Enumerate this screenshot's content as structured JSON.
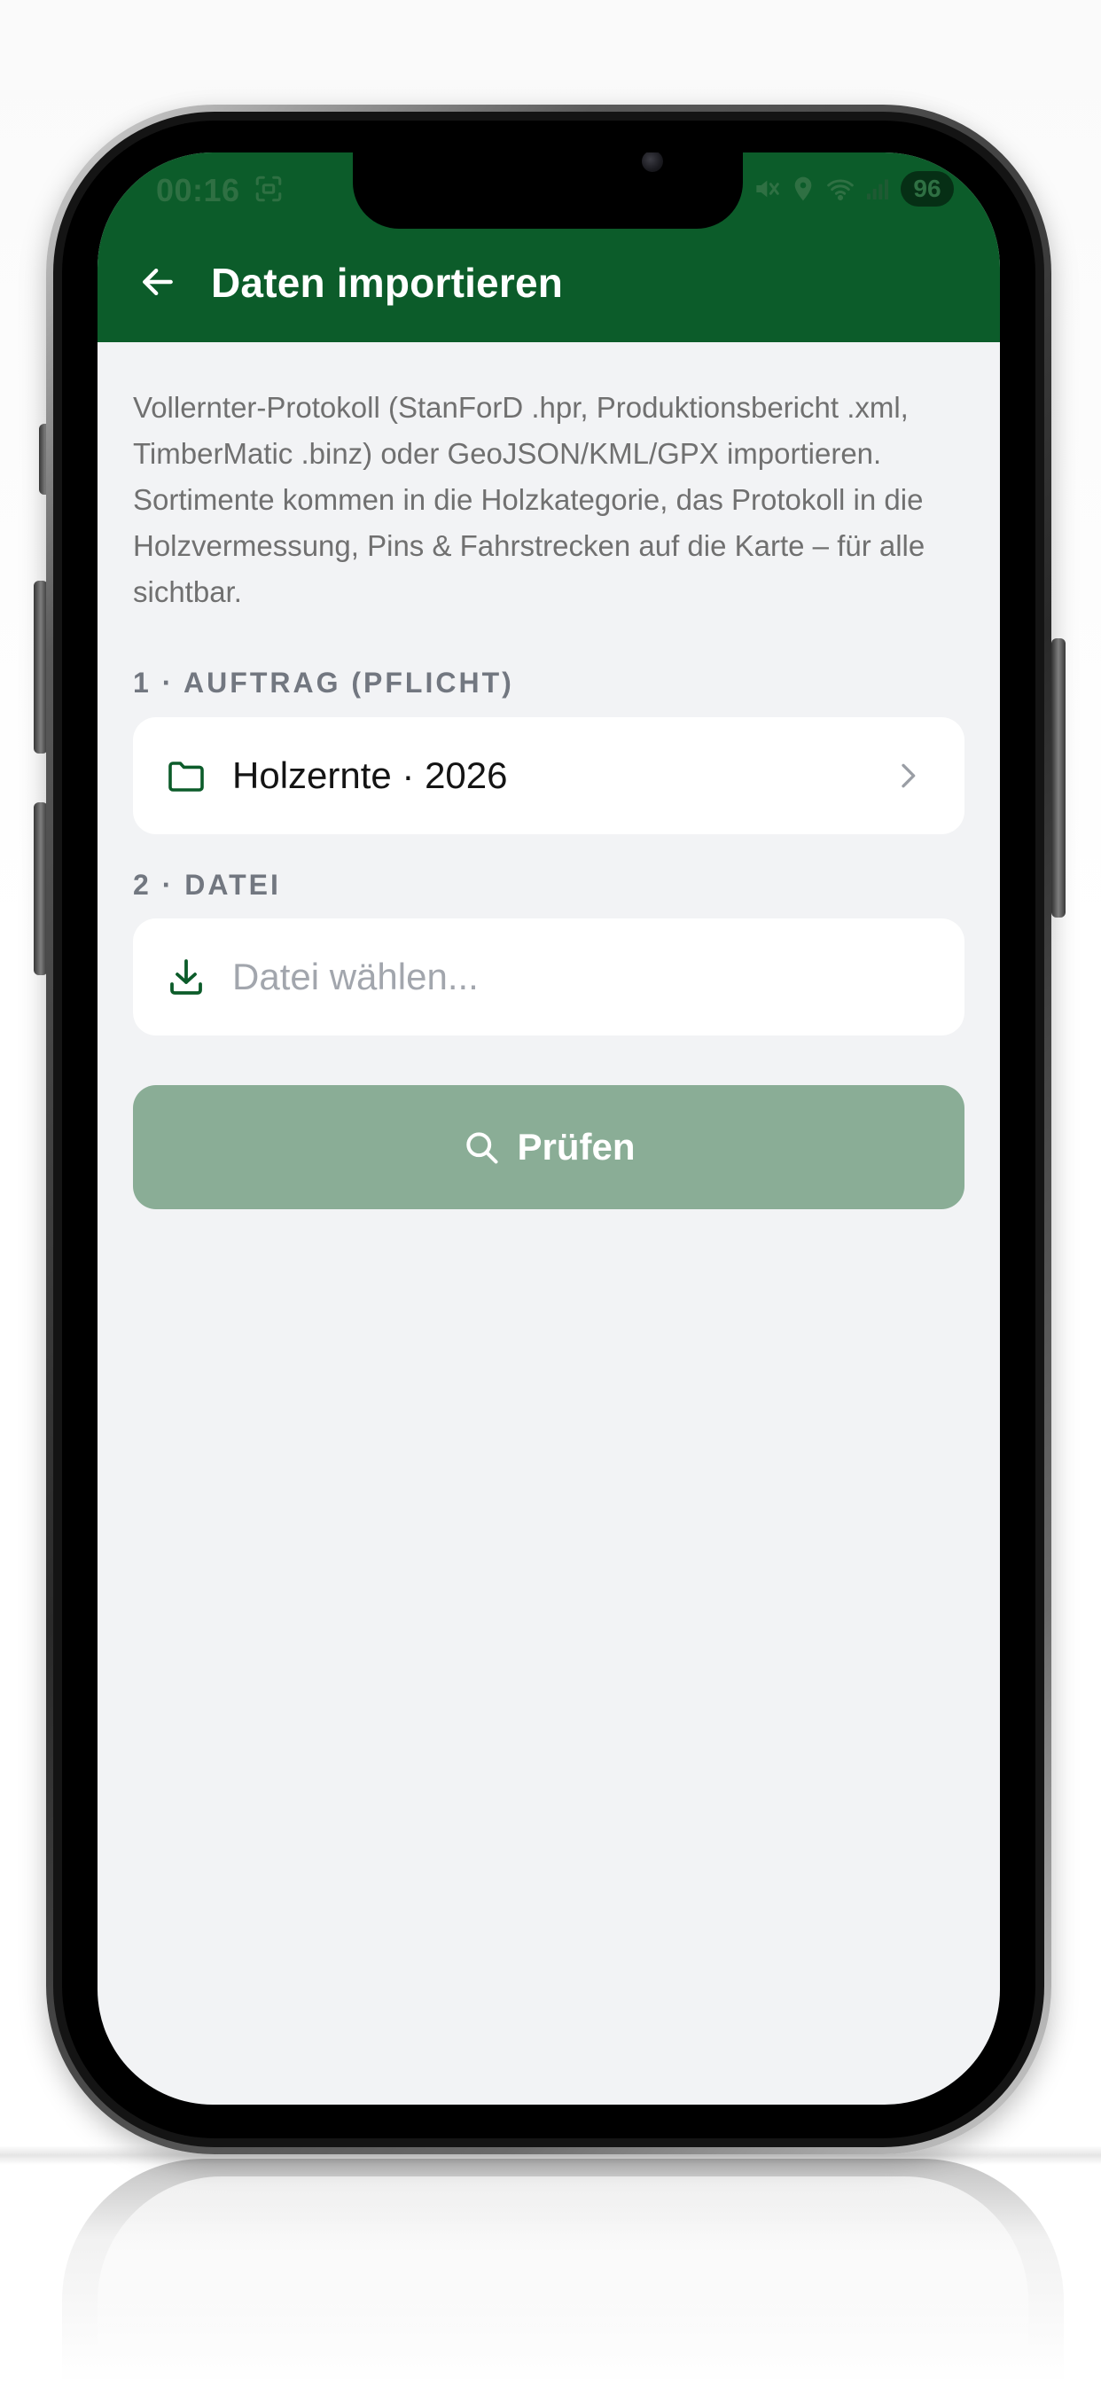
{
  "status_bar": {
    "time": "00:16",
    "battery": "96"
  },
  "header": {
    "title": "Daten importieren"
  },
  "intro": {
    "text": "Vollernter-Protokoll (StanForD .hpr, Produktionsbericht .xml, TimberMatic .binz) oder GeoJSON/KML/GPX importieren. Sortimente kommen in die Holzkategorie, das Protokoll in die Holzvermessung, Pins & Fahrstrecken auf die Karte – für alle sichtbar."
  },
  "step_order": {
    "label": "1 · AUFTRAG (PFLICHT)",
    "value": "Holzernte · 2026",
    "icon": "folder-icon"
  },
  "step_file": {
    "label": "2 · DATEI",
    "placeholder": "Datei wählen...",
    "icon": "download-icon"
  },
  "check_button": {
    "label": "Prüfen",
    "icon": "search-icon"
  },
  "colors": {
    "header_green": "#0c5c2a",
    "button_disabled_green": "#8aad96",
    "background": "#f2f3f5"
  }
}
